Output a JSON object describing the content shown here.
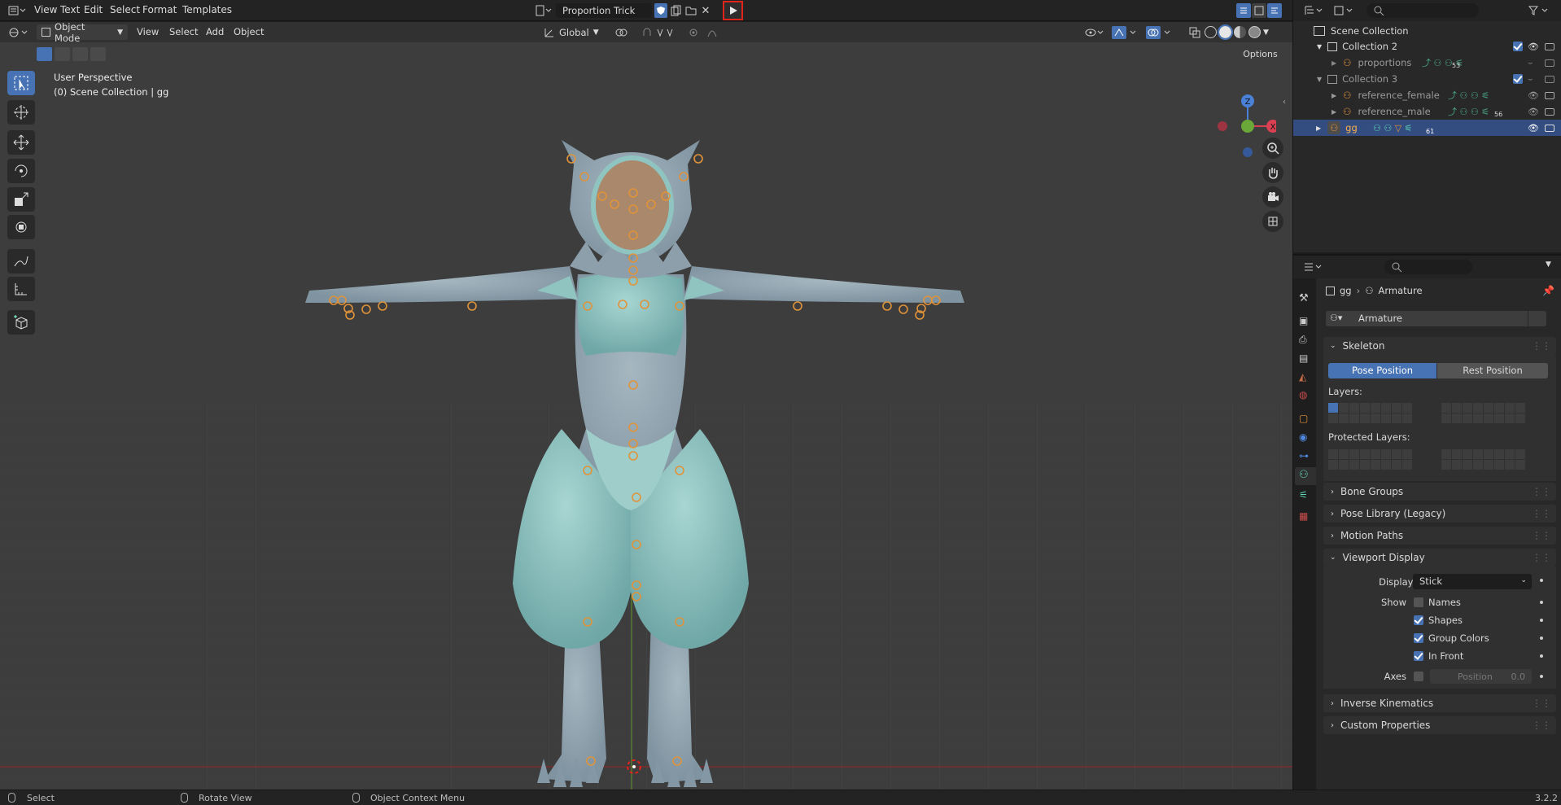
{
  "top_menu": {
    "items": [
      "View",
      "Text",
      "Edit",
      "Select",
      "Format",
      "Templates"
    ]
  },
  "text_editor": {
    "filename": "Proportion Trick"
  },
  "viewport_header": {
    "mode": "Object Mode",
    "menus": [
      "View",
      "Select",
      "Add",
      "Object"
    ],
    "orientation": "Global",
    "options": "Options"
  },
  "viewport": {
    "perspective": "User Perspective",
    "collection": "(0) Scene Collection | gg",
    "gizmo": {
      "z": "Z",
      "y": "Y",
      "x": "X"
    }
  },
  "outliner": {
    "rows": [
      {
        "label": "Scene Collection"
      },
      {
        "label": "Collection 2"
      },
      {
        "label": "proportions",
        "count": "53"
      },
      {
        "label": "Collection 3"
      },
      {
        "label": "reference_female"
      },
      {
        "label": "reference_male",
        "count": "56"
      },
      {
        "label": "gg",
        "count": "61"
      }
    ]
  },
  "properties": {
    "breadcrumb": {
      "object": "gg",
      "data": "Armature"
    },
    "datablock": "Armature",
    "skeleton": {
      "title": "Skeleton",
      "pose_btn": "Pose Position",
      "rest_btn": "Rest Position",
      "layers_label": "Layers:",
      "protected_label": "Protected Layers:"
    },
    "sections": {
      "bone_groups": "Bone Groups",
      "pose_library": "Pose Library (Legacy)",
      "motion_paths": "Motion Paths",
      "viewport_display": "Viewport Display",
      "inverse_kinematics": "Inverse Kinematics",
      "custom_properties": "Custom Properties"
    },
    "viewport_display": {
      "display_as_label": "Display As",
      "display_as_value": "Stick",
      "show_label": "Show",
      "names": "Names",
      "shapes": "Shapes",
      "group_colors": "Group Colors",
      "in_front": "In Front",
      "axes_label": "Axes",
      "position_label": "Position",
      "position_value": "0.0"
    }
  },
  "status": {
    "select": "Select",
    "rotate": "Rotate View",
    "context": "Object Context Menu",
    "version": "3.2.2"
  },
  "colors": {
    "accent": "#4772b3",
    "selected_row": "#334d80",
    "highlight": "#e0241b",
    "bone": "#e0933a",
    "mesh": "#8ea9b1",
    "teal": "#8fc4c0"
  }
}
